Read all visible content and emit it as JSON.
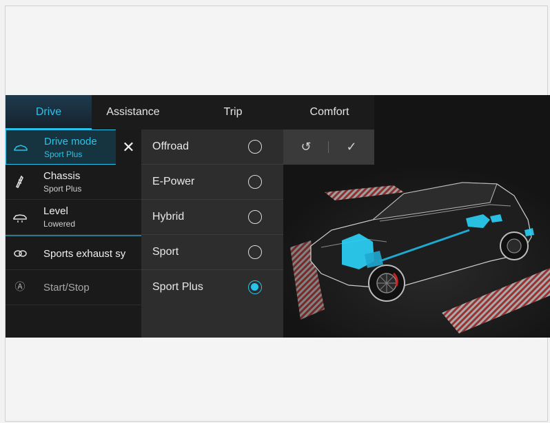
{
  "tabs": [
    {
      "label": "Drive"
    },
    {
      "label": "Assistance"
    },
    {
      "label": "Trip"
    },
    {
      "label": "Comfort"
    }
  ],
  "left_list": [
    {
      "title": "Drive mode",
      "subtitle": "Sport Plus",
      "icon": "car-side-icon"
    },
    {
      "title": "Chassis",
      "subtitle": "Sport Plus",
      "icon": "spring-icon"
    },
    {
      "title": "Level",
      "subtitle": "Lowered",
      "icon": "car-level-icon"
    },
    {
      "title": "Sports exhaust sy",
      "icon": "exhaust-icon"
    },
    {
      "title": "Start/Stop",
      "icon": "auto-start-stop-icon",
      "icon_glyph": "Ⓐ"
    }
  ],
  "close": {
    "glyph": "✕"
  },
  "drive_modes": [
    {
      "label": "Offroad",
      "selected": false
    },
    {
      "label": "E-Power",
      "selected": false
    },
    {
      "label": "Hybrid",
      "selected": false
    },
    {
      "label": "Sport",
      "selected": false
    },
    {
      "label": "Sport Plus",
      "selected": true
    }
  ],
  "actions": {
    "undo_glyph": "↺",
    "confirm_glyph": "✓"
  },
  "colors": {
    "accent": "#27c3ea",
    "background": "#141414",
    "popup": "#2d2d2d"
  }
}
